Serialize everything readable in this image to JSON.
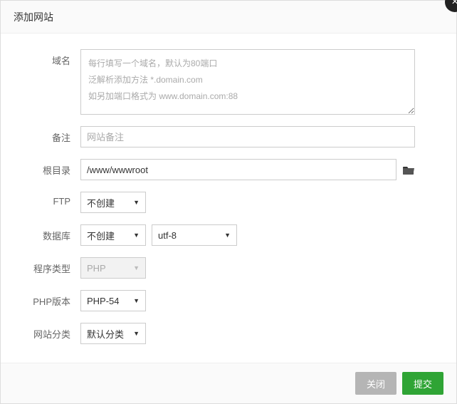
{
  "header": {
    "title": "添加网站"
  },
  "form": {
    "domain": {
      "label": "域名",
      "placeholder": "每行填写一个域名，默认为80端口\n泛解析添加方法 *.domain.com\n如另加端口格式为 www.domain.com:88",
      "value": ""
    },
    "remark": {
      "label": "备注",
      "placeholder": "网站备注",
      "value": ""
    },
    "root": {
      "label": "根目录",
      "value": "/www/wwwroot"
    },
    "ftp": {
      "label": "FTP",
      "selected": "不创建"
    },
    "database": {
      "label": "数据库",
      "selected": "不创建",
      "charset": "utf-8"
    },
    "programType": {
      "label": "程序类型",
      "selected": "PHP"
    },
    "phpVersion": {
      "label": "PHP版本",
      "selected": "PHP-54"
    },
    "category": {
      "label": "网站分类",
      "selected": "默认分类"
    }
  },
  "footer": {
    "cancel": "关闭",
    "submit": "提交"
  }
}
